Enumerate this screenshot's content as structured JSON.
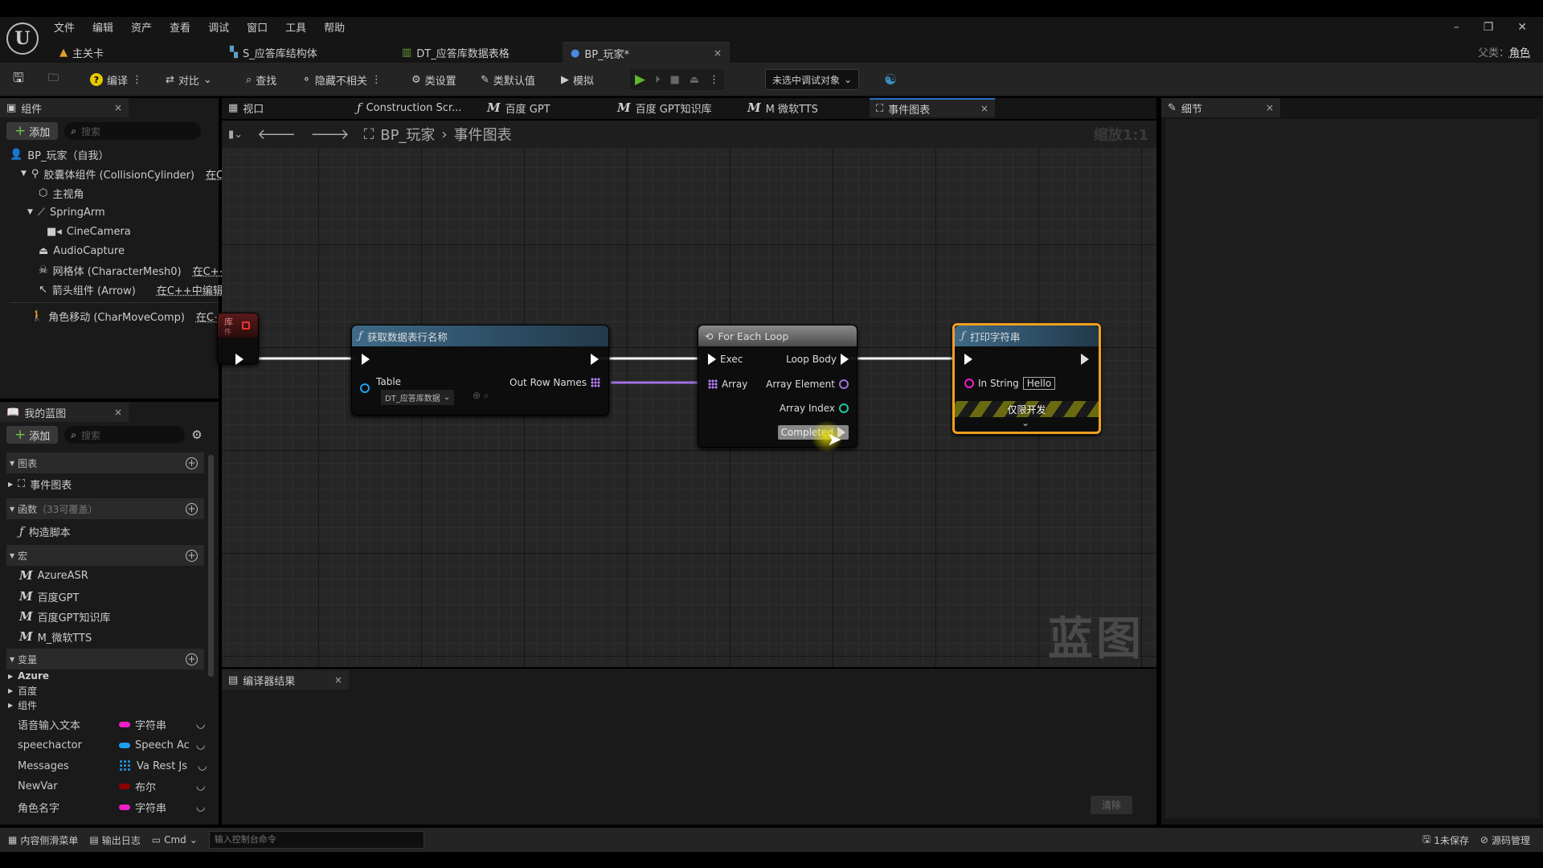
{
  "menu": [
    "文件",
    "编辑",
    "资产",
    "查看",
    "调试",
    "窗口",
    "工具",
    "帮助"
  ],
  "doc_tabs": [
    {
      "label": "主关卡"
    },
    {
      "label": "S_应答库结构体"
    },
    {
      "label": "DT_应答库数据表格"
    },
    {
      "label": "BP_玩家*",
      "active": true
    }
  ],
  "parent_class": {
    "label": "父类：",
    "value": "角色"
  },
  "toolbar": {
    "compile": "编译",
    "diff": "对比",
    "find": "查找",
    "hide_unrelated": "隐藏不相关",
    "class_settings": "类设置",
    "class_defaults": "类默认值",
    "simulate": "模拟",
    "debug_target": "未选中调试对象"
  },
  "components": {
    "tab": "组件",
    "add": "添加",
    "search_placeholder": "搜索",
    "items": [
      {
        "label": "BP_玩家（自我）"
      },
      {
        "label": "胶囊体组件 (CollisionCylinder)",
        "link": "在C+"
      },
      {
        "label": "主视角"
      },
      {
        "label": "SpringArm"
      },
      {
        "label": "CineCamera"
      },
      {
        "label": "AudioCapture"
      },
      {
        "label": "网格体 (CharacterMesh0)",
        "link": "在C++中"
      },
      {
        "label": "箭头组件 (Arrow)",
        "link": "在C++中编辑"
      },
      {
        "label": "角色移动 (CharMoveComp)",
        "link": "在C++中"
      }
    ]
  },
  "my_blueprint": {
    "tab": "我的蓝图",
    "add": "添加",
    "search_placeholder": "搜索",
    "graphs": {
      "title": "图表",
      "items": [
        "事件图表"
      ]
    },
    "functions": {
      "title": "函数",
      "note": "（33可覆盖）",
      "items": [
        "构造脚本"
      ]
    },
    "macros": {
      "title": "宏",
      "items": [
        "AzureASR",
        "百度GPT",
        "百度GPT知识库",
        "M_微软TTS"
      ]
    },
    "variables": {
      "title": "变量",
      "categories": [
        "Azure",
        "百度",
        "组件"
      ],
      "items": [
        {
          "name": "语音输入文本",
          "type": "字符串",
          "color": "#f01ec8"
        },
        {
          "name": "speechactor",
          "type": "Speech Ac",
          "color": "#1ea0f0"
        },
        {
          "name": "Messages",
          "type": "Va Rest Js",
          "color": "#1e90e0",
          "array": true
        },
        {
          "name": "NewVar",
          "type": "布尔",
          "color": "#8c0000"
        },
        {
          "name": "角色名字",
          "type": "字符串",
          "color": "#f01ec8"
        }
      ]
    }
  },
  "editor_tabs": [
    {
      "label": "视口"
    },
    {
      "label": "Construction Scr..."
    },
    {
      "label": "百度 GPT"
    },
    {
      "label": "百度 GPT知识库"
    },
    {
      "label": "M 微软TTS"
    },
    {
      "label": "事件图表",
      "active": true
    }
  ],
  "breadcrumb": {
    "root": "BP_玩家",
    "current": "事件图表"
  },
  "zoom": "缩放1:1",
  "watermark": "蓝图",
  "nodes": {
    "partial": {
      "title": "库",
      "sub": "件"
    },
    "get_row_names": {
      "title": "获取数据表行名称",
      "table_label": "Table",
      "table_value": "DT_应答库数据",
      "out": "Out Row Names"
    },
    "for_each": {
      "title": "For Each Loop",
      "exec": "Exec",
      "loop_body": "Loop Body",
      "array": "Array",
      "array_element": "Array Element",
      "array_index": "Array Index",
      "completed": "Completed"
    },
    "print_string": {
      "title": "打印字符串",
      "in_string": "In String",
      "in_value": "Hello",
      "dev_only": "仅限开发"
    }
  },
  "details": {
    "tab": "细节"
  },
  "compiler": {
    "tab": "编译器结果",
    "clear": "清除"
  },
  "status": {
    "content_drawer": "内容侧滑菜单",
    "output_log": "输出日志",
    "cmd": "Cmd",
    "console_placeholder": "输入控制台命令",
    "unsaved": "1未保存",
    "source_control": "源码管理"
  }
}
